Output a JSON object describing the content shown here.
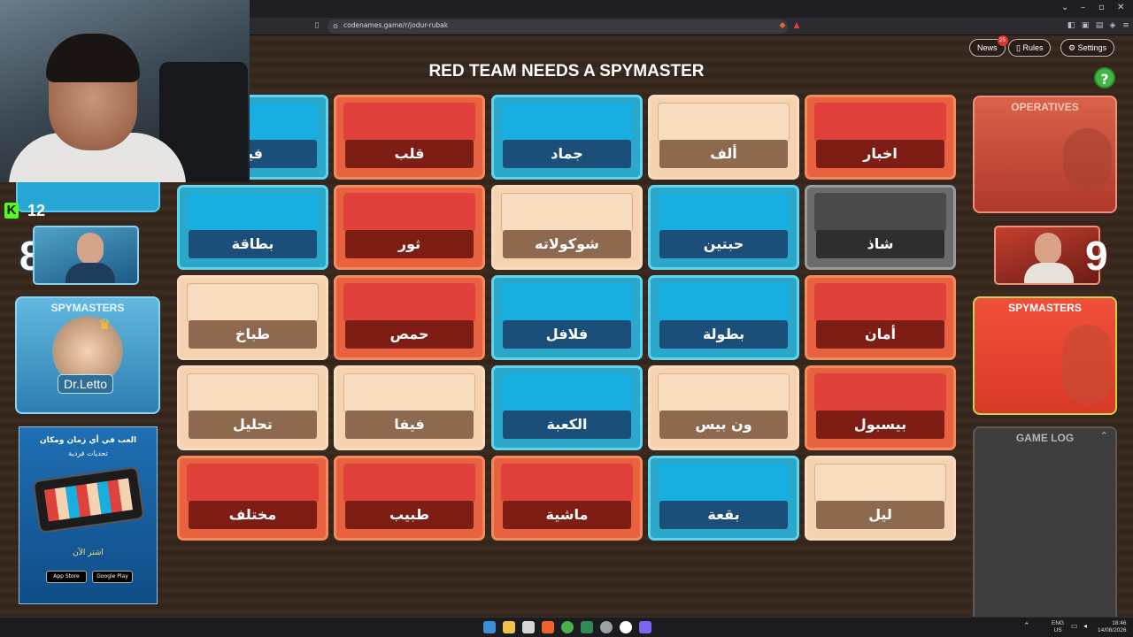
{
  "browser": {
    "url": "codenames.game/r/jodur-rubak"
  },
  "header": {
    "heading": "RED TEAM NEEDS A SPYMASTER",
    "news_label": "News",
    "news_count": "25",
    "rules_label": "Rules",
    "settings_label": "Settings",
    "help_label": "?"
  },
  "colors": {
    "red": "#e0413a",
    "blue": "#19aee0",
    "neutral": "#f5d3b0",
    "assassin": "#4a4a4a",
    "help": "#3fb743"
  },
  "board": {
    "cards": [
      {
        "word": "فيا",
        "type": "blue"
      },
      {
        "word": "قلب",
        "type": "red"
      },
      {
        "word": "جماد",
        "type": "blue"
      },
      {
        "word": "ألف",
        "type": "neutral"
      },
      {
        "word": "اخبار",
        "type": "red"
      },
      {
        "word": "بطاقة",
        "type": "blue"
      },
      {
        "word": "ثور",
        "type": "red"
      },
      {
        "word": "شوكولاته",
        "type": "neutral"
      },
      {
        "word": "حبتين",
        "type": "blue"
      },
      {
        "word": "شاذ",
        "type": "assassin"
      },
      {
        "word": "طباخ",
        "type": "neutral"
      },
      {
        "word": "حمص",
        "type": "red"
      },
      {
        "word": "فلافل",
        "type": "blue"
      },
      {
        "word": "بطولة",
        "type": "blue"
      },
      {
        "word": "أمان",
        "type": "red"
      },
      {
        "word": "تحليل",
        "type": "neutral"
      },
      {
        "word": "فيفا",
        "type": "neutral"
      },
      {
        "word": "الكعبة",
        "type": "blue"
      },
      {
        "word": "ون بيس",
        "type": "neutral"
      },
      {
        "word": "بيسبول",
        "type": "red"
      },
      {
        "word": "مختلف",
        "type": "red"
      },
      {
        "word": "طبيب",
        "type": "red"
      },
      {
        "word": "ماشية",
        "type": "red"
      },
      {
        "word": "بقعة",
        "type": "blue"
      },
      {
        "word": "ليل",
        "type": "neutral"
      }
    ]
  },
  "blue_team": {
    "score": "8",
    "spymasters_label": "SPYMASTERS",
    "spymaster_name": "Dr.Letto"
  },
  "red_team": {
    "score": "9",
    "operatives_label": "OPERATIVES",
    "spymasters_label": "SPYMASTERS"
  },
  "game_log": {
    "title": "GAME LOG"
  },
  "stream_overlay": {
    "kick_count": "12"
  },
  "ad": {
    "headline": "العب في أي زمان ومكان",
    "subline": "تحديات فردية",
    "cta": "اشتر الآن",
    "app_store": "App Store",
    "google_play": "Google Play"
  },
  "taskbar": {
    "lang_top": "ENG",
    "lang_bottom": "US",
    "time": "18:46",
    "date": "14/08/2026"
  }
}
